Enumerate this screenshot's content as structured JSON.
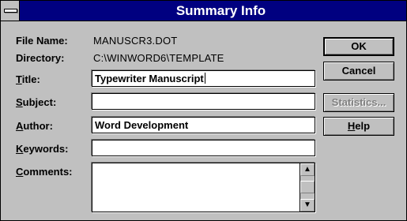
{
  "window": {
    "title": "Summary Info",
    "system_menu_icon": "system-menu-bar"
  },
  "info": {
    "file_name_label": "File Name:",
    "file_name_value": "MANUSCR3.DOT",
    "directory_label": "Directory:",
    "directory_value": "C:\\WINWORD6\\TEMPLATE"
  },
  "fields": {
    "title": {
      "label_key": "T",
      "label_rest": "itle:",
      "value": "Typewriter Manuscript"
    },
    "subject": {
      "label_key": "S",
      "label_rest": "ubject:",
      "value": ""
    },
    "author": {
      "label_key": "A",
      "label_rest": "uthor:",
      "value": "Word Development"
    },
    "keywords": {
      "label_key": "K",
      "label_rest": "eywords:",
      "value": ""
    },
    "comments": {
      "label_key": "C",
      "label_rest": "omments:",
      "value": ""
    }
  },
  "buttons": {
    "ok": "OK",
    "cancel": "Cancel",
    "statistics": "Statistics...",
    "help_key": "H",
    "help_rest": "elp"
  },
  "scrollbar": {
    "up_glyph": "▲",
    "down_glyph": "▼"
  }
}
